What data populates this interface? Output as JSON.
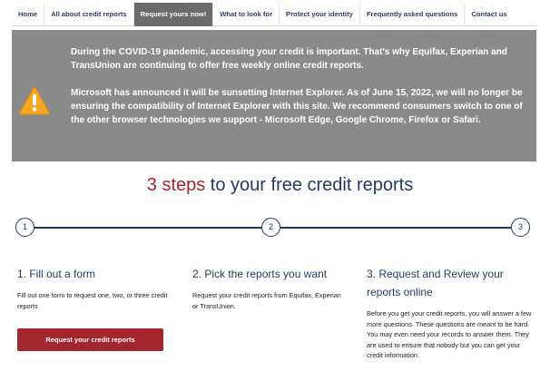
{
  "nav": {
    "tabs": [
      {
        "label": "Home"
      },
      {
        "label": "All about credit reports"
      },
      {
        "label": "Request yours now!"
      },
      {
        "label": "What to look for"
      },
      {
        "label": "Protect your identity"
      },
      {
        "label": "Frequently asked questions"
      },
      {
        "label": "Contact us"
      }
    ],
    "active_index": 2
  },
  "alert": {
    "icon": "warning-triangle-icon",
    "icon_color": "#f5a623",
    "paragraph_1": "During the COVID-19 pandemic, accessing your credit is important. That's why Equifax, Experian and TransUnion are continuing to offer free weekly online credit reports.",
    "paragraph_2": "Microsoft has announced it will be sunsetting Internet Explorer. As of June 15, 2022, we will no longer be ensuring the compatibility of Internet Explorer with this site. We recommend consumers switch to one of the other browser technologies we support - Microsoft Edge, Google Chrome, Firefox or Safari."
  },
  "heading": {
    "accent": "3 steps",
    "rest": " to your free credit reports"
  },
  "steps": [
    {
      "number": "1",
      "title": "1. Fill out a form",
      "text": "Fill out one form to request one, two, or three credit reports",
      "button_label": "Request your credit reports"
    },
    {
      "number": "2",
      "title": "2. Pick the reports you want",
      "text": "Request your credit reports from Equifax, Experian or TransUnion."
    },
    {
      "number": "3",
      "title": "3. Request and Review your reports online",
      "text": "Before you get your credit reports, you will answer a few more questions. These questions are meant to be hard. You may even need your records to answer them. They are used to ensure that nobody but you can get your credit information."
    }
  ],
  "colors": {
    "navy": "#1f3a5f",
    "accent_red": "#a8242c",
    "alert_bg": "#8a8a8a"
  }
}
